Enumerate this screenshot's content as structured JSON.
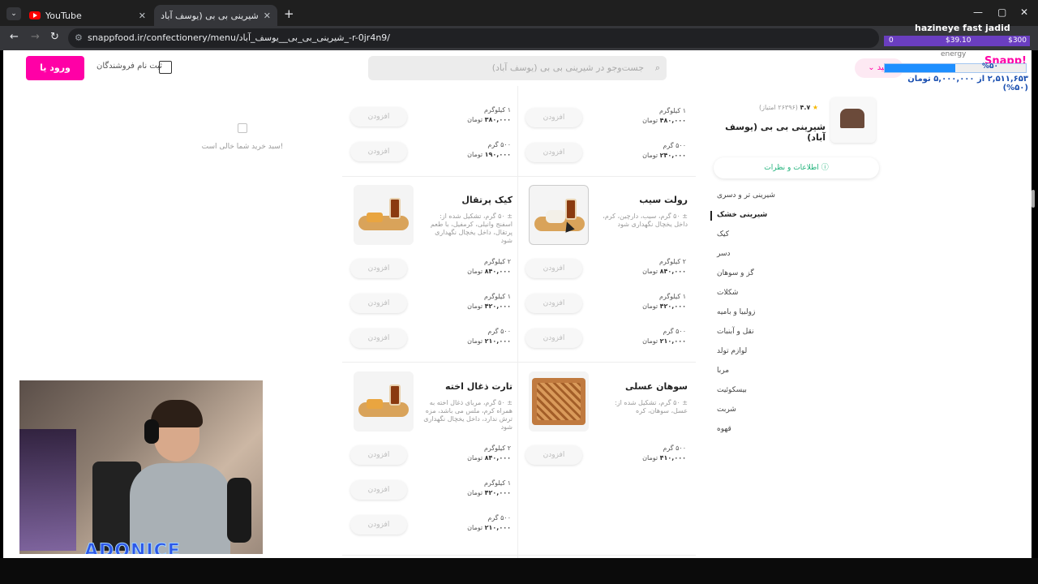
{
  "browser": {
    "tabs": [
      {
        "title": "YouTube"
      },
      {
        "title": "شیرینی بی بی (یوسف آباد)-سفا"
      }
    ],
    "new_tab": "+",
    "url": "snappfood.ir/confectionery/menu/شیرینی_بی_بی__یوسف_آباد_-r-0jr4n9/",
    "window_controls": [
      "—",
      "▢",
      "✕"
    ]
  },
  "header": {
    "login_label": "ورود یا عضویت",
    "vendor_register": "ثبت نام فروشندگان",
    "search_placeholder": "جست‌وجو در شیرینی بی بی (یوسف آباد)",
    "address_pill": "کنید",
    "logo": "Snapp!"
  },
  "cart": {
    "empty_text": "سبد خرید شما خالی است!"
  },
  "add_label": "افزودن",
  "top_row": {
    "left": [
      {
        "size": "۱ کیلوگرم",
        "amount": "۳۸۰,۰۰۰",
        "unit": "تومان"
      },
      {
        "size": "۵۰۰ گرم",
        "amount": "۱۹۰,۰۰۰",
        "unit": "تومان"
      }
    ],
    "right": [
      {
        "size": "۱ کیلوگرم",
        "amount": "۴۸۰,۰۰۰",
        "unit": "تومان"
      },
      {
        "size": "۵۰۰ گرم",
        "amount": "۲۴۰,۰۰۰",
        "unit": "تومان"
      }
    ]
  },
  "products": [
    {
      "title": "کیک پرتقال",
      "desc": "± ۵۰ گرم، تشکیل شده از: اسفنج وانیلی، کرمفیل، با طعم پرتقال، داخل یخچال نگهداری شود",
      "prices": [
        {
          "size": "۲ کیلوگرم",
          "amount": "۸۴۰,۰۰۰",
          "unit": "تومان"
        },
        {
          "size": "۱ کیلوگرم",
          "amount": "۴۲۰,۰۰۰",
          "unit": "تومان"
        },
        {
          "size": "۵۰۰ گرم",
          "amount": "۲۱۰,۰۰۰",
          "unit": "تومان"
        }
      ]
    },
    {
      "title": "رولت سیب",
      "desc": "± ۵۰ گرم، سیب، دارچین، کرم، داخل یخچال نگهداری شود",
      "prices": [
        {
          "size": "۲ کیلوگرم",
          "amount": "۸۴۰,۰۰۰",
          "unit": "تومان"
        },
        {
          "size": "۱ کیلوگرم",
          "amount": "۴۲۰,۰۰۰",
          "unit": "تومان"
        },
        {
          "size": "۵۰۰ گرم",
          "amount": "۲۱۰,۰۰۰",
          "unit": "تومان"
        }
      ]
    },
    {
      "title": "تارت ذغال اخته",
      "desc": "± ۵۰ گرم، مربای ذغال اخته به همراه کرم، ملس می باشد، مزه ترش ندارد، داخل یخچال نگهداری شود",
      "prices": [
        {
          "size": "۲ کیلوگرم",
          "amount": "۸۴۰,۰۰۰",
          "unit": "تومان"
        },
        {
          "size": "۱ کیلوگرم",
          "amount": "۴۲۰,۰۰۰",
          "unit": "تومان"
        },
        {
          "size": "۵۰۰ گرم",
          "amount": "۲۱۰,۰۰۰",
          "unit": "تومان"
        }
      ]
    },
    {
      "title": "سوهان عسلی",
      "desc": "± ۵۰ گرم، تشکیل شده از: عسل، سوهان، کره",
      "prices": [
        {
          "size": "۵۰۰ گرم",
          "amount": "۴۱۰,۰۰۰",
          "unit": "تومان"
        }
      ]
    }
  ],
  "vendor": {
    "score": "۴.۷",
    "rating_count": "(۲۶۳۹۶ امتیاز)",
    "name": "شیرینی بی بی (یوسف آباد)",
    "info_button": "اطلاعات و نظرات"
  },
  "categories": [
    "شیرینی تر و دسری",
    "شیرینی خشک",
    "کیک",
    "دسر",
    "گز و سوهان",
    "شکلات",
    "زولبیا و بامیه",
    "نقل و آبنبات",
    "لوازم تولد",
    "مربا",
    "بیسکوئیت",
    "شربت",
    "قهوه"
  ],
  "active_category": "شیرینی خشک",
  "overlay": {
    "title": "hazineye fast jadid",
    "bar_low": "0",
    "bar_mid": "$39.10",
    "bar_high": "$300",
    "energy_label": "energy",
    "progress_pct": "%۵۰",
    "progress_fraction": 0.5,
    "progress_text": "۲,۵۱۱,۶۵۳ از ۵,۰۰۰,۰۰۰ تومان (۵۰%)"
  },
  "stream": {
    "watermark": "ADONICE"
  }
}
